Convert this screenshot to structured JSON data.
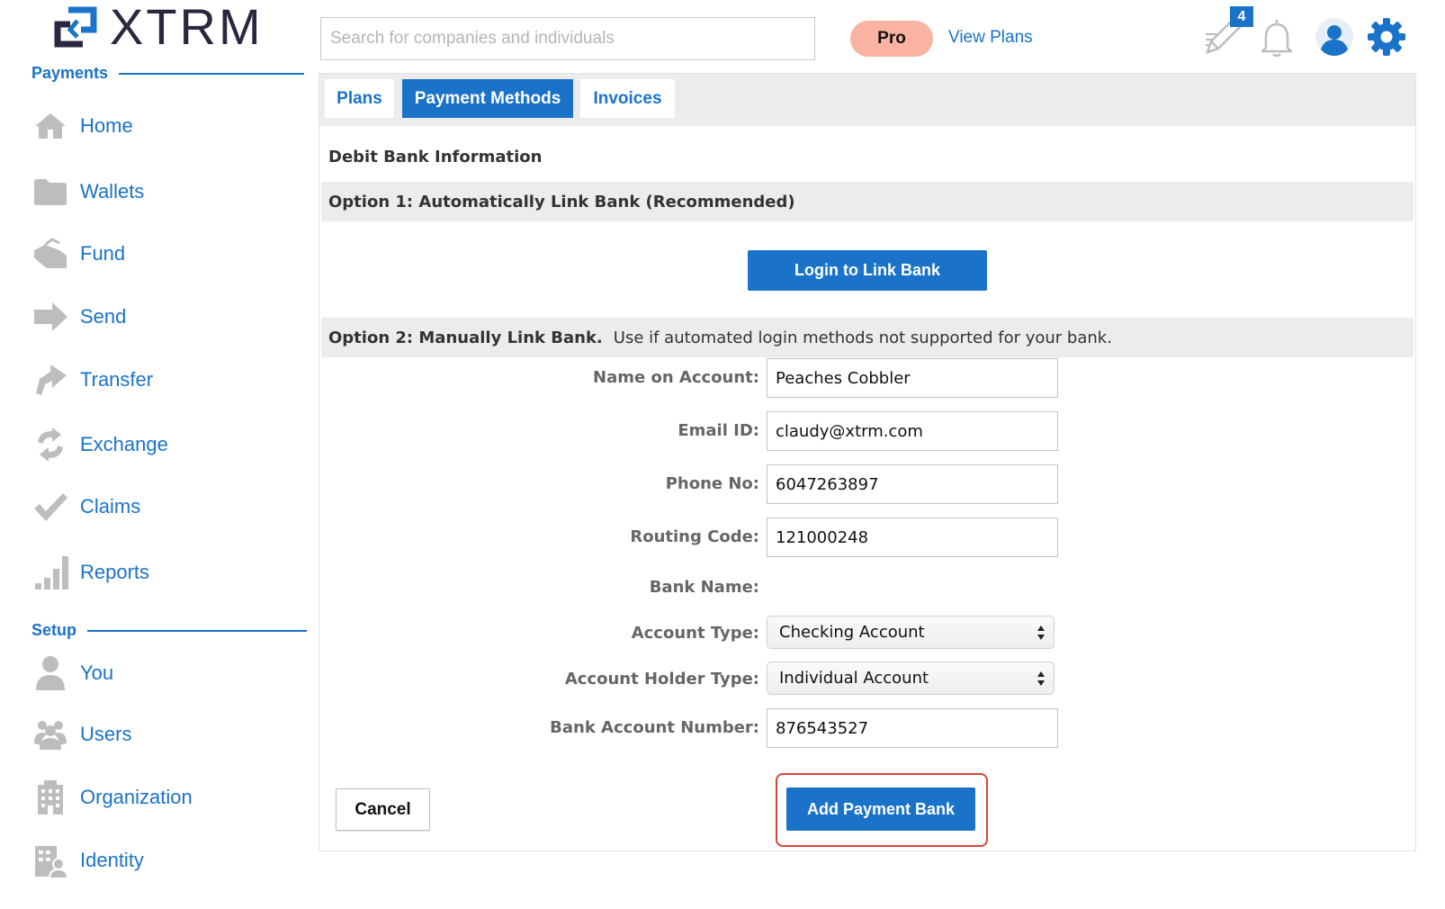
{
  "brand": {
    "name": "XTRM"
  },
  "header": {
    "search_placeholder": "Search for companies and individuals",
    "plan_badge": "Pro",
    "view_plans": "View Plans",
    "notification_count": "4",
    "icons": [
      "edit-pen-icon",
      "bell-icon",
      "user-avatar-icon",
      "gear-icon"
    ]
  },
  "sidebar": {
    "payments_heading": "Payments",
    "setup_heading": "Setup",
    "payments_items": [
      {
        "label": "Home",
        "icon": "home-icon"
      },
      {
        "label": "Wallets",
        "icon": "folder-icon"
      },
      {
        "label": "Fund",
        "icon": "fund-hand-icon"
      },
      {
        "label": "Send",
        "icon": "send-arrow-icon"
      },
      {
        "label": "Transfer",
        "icon": "transfer-arrow-icon"
      },
      {
        "label": "Exchange",
        "icon": "exchange-arrows-icon"
      },
      {
        "label": "Claims",
        "icon": "checkmark-icon"
      },
      {
        "label": "Reports",
        "icon": "bar-chart-icon"
      }
    ],
    "setup_items": [
      {
        "label": "You",
        "icon": "person-icon"
      },
      {
        "label": "Users",
        "icon": "users-group-icon"
      },
      {
        "label": "Organization",
        "icon": "building-icon"
      },
      {
        "label": "Identity",
        "icon": "identity-icon"
      }
    ]
  },
  "tabs": [
    {
      "label": "Plans",
      "active": false
    },
    {
      "label": "Payment Methods",
      "active": true
    },
    {
      "label": "Invoices",
      "active": false
    }
  ],
  "content": {
    "title": "Debit Bank Information",
    "option1_title": "Option 1: Automatically Link Bank (Recommended)",
    "login_button": "Login to Link Bank",
    "option2_title": "Option 2: Manually Link Bank.",
    "option2_note": "Use if automated login methods not supported for your bank."
  },
  "form": {
    "name_label": "Name on Account:",
    "name_value": "Peaches Cobbler",
    "email_label": "Email ID:",
    "email_value": "claudy@xtrm.com",
    "phone_label": "Phone No:",
    "phone_value": "6047263897",
    "routing_label": "Routing Code:",
    "routing_value": "121000248",
    "bank_name_label": "Bank Name:",
    "account_type_label": "Account Type:",
    "account_type_value": "Checking Account",
    "holder_type_label": "Account Holder Type:",
    "holder_type_value": "Individual Account",
    "account_number_label": "Bank Account Number:",
    "account_number_value": "876543527"
  },
  "actions": {
    "cancel": "Cancel",
    "add_payment_bank": "Add Payment Bank"
  },
  "colors": {
    "accent": "#1a73c8",
    "pro_badge": "#f9b3a0",
    "highlight": "#d9443a",
    "icon_gray": "#bdbdbd"
  }
}
